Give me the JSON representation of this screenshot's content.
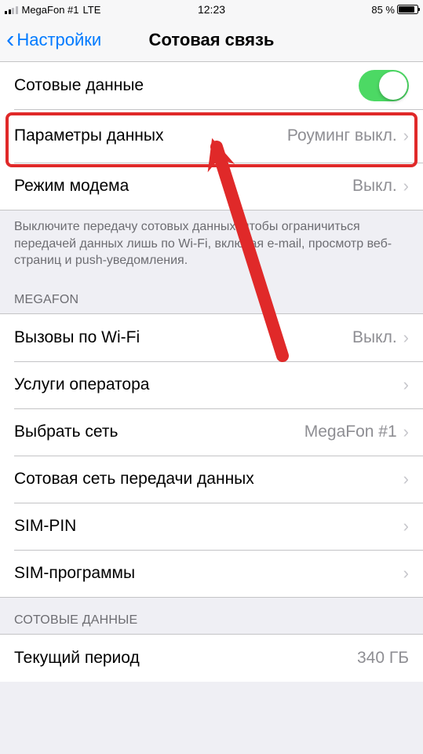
{
  "status_bar": {
    "carrier": "MegaFon #1",
    "network": "LTE",
    "time": "12:23",
    "battery_pct": "85 %"
  },
  "nav": {
    "back_label": "Настройки",
    "title": "Сотовая связь"
  },
  "section1": {
    "cellular_data_label": "Сотовые данные",
    "data_options_label": "Параметры данных",
    "data_options_value": "Роуминг выкл.",
    "hotspot_label": "Режим модема",
    "hotspot_value": "Выкл."
  },
  "description_text": "Выключите передачу сотовых данных, чтобы ограничиться передачей данных лишь по Wi-Fi, включая e-mail, просмотр веб-страниц и push-уведомления.",
  "carrier_header": "MEGAFON",
  "carrier_section": {
    "wifi_calling_label": "Вызовы по Wi-Fi",
    "wifi_calling_value": "Выкл.",
    "carrier_services_label": "Услуги оператора",
    "network_select_label": "Выбрать сеть",
    "network_select_value": "MegaFon #1",
    "cellular_data_network_label": "Сотовая сеть передачи данных",
    "sim_pin_label": "SIM-PIN",
    "sim_apps_label": "SIM-программы"
  },
  "usage_header": "СОТОВЫЕ ДАННЫЕ",
  "usage_section": {
    "current_period_label": "Текущий период",
    "current_period_value": "340 ГБ"
  }
}
